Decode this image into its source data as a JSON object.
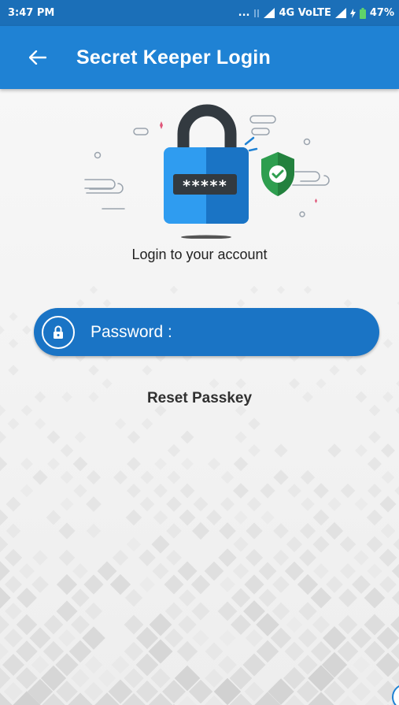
{
  "status_bar": {
    "time": "3:47 PM",
    "dots": "...",
    "network": "4G VoLTE",
    "battery": "47%"
  },
  "app_bar": {
    "title": "Secret Keeper Login",
    "back_icon": "arrow-left-icon"
  },
  "login": {
    "subtitle": "Login to your account",
    "password_label": "Password :",
    "password_icon": "padlock-icon",
    "masked_password": "*****",
    "reset_link": "Reset Passkey"
  },
  "colors": {
    "status_bar": "#1b6fb8",
    "app_bar": "#1f82d4",
    "pill": "#1a74c5",
    "shield": "#2e9e4f",
    "background": "#f3f3f3"
  }
}
